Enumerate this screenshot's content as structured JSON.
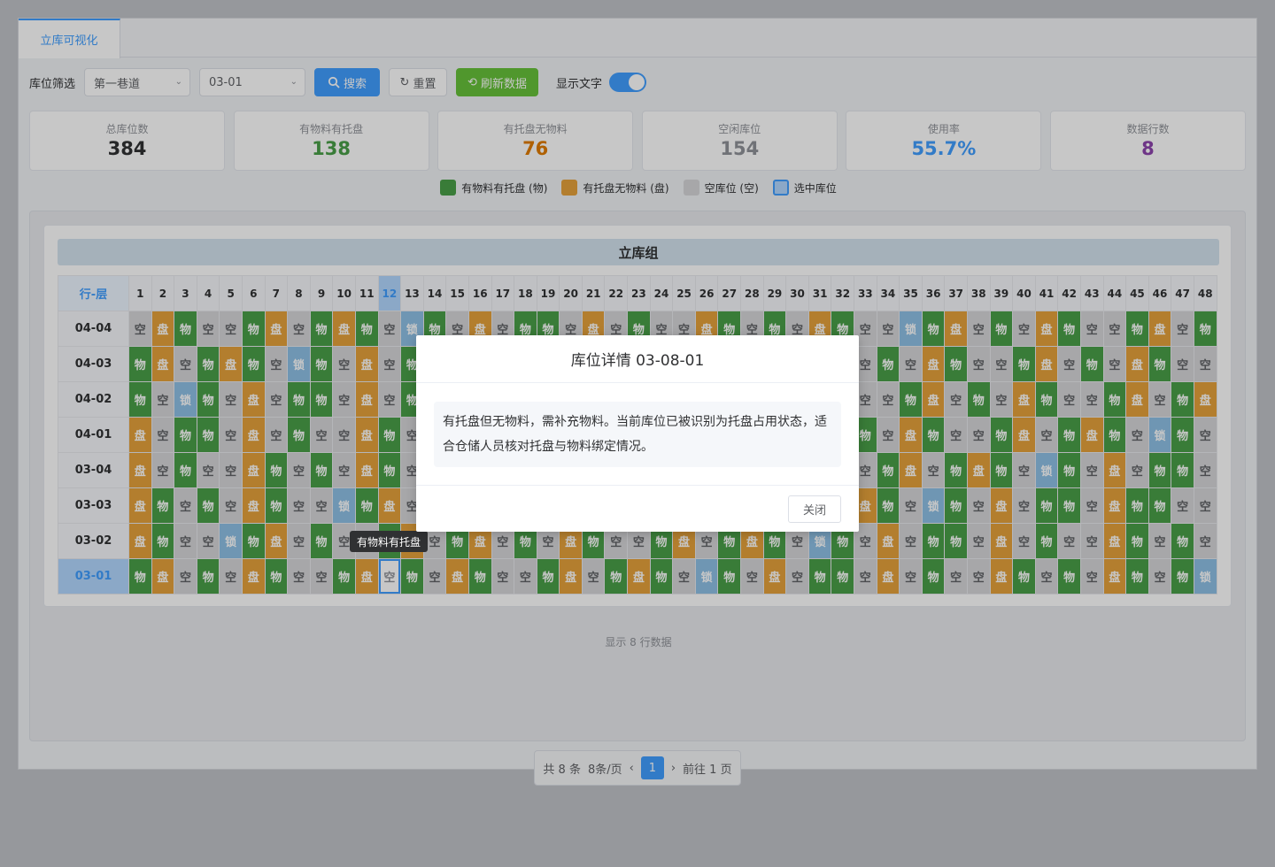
{
  "tab": {
    "label": "立库可视化"
  },
  "filter": {
    "label": "库位筛选",
    "lane": "第一巷道",
    "position": "03-01",
    "search_label": "搜索",
    "reset_label": "重置",
    "refresh_label": "刷新数据",
    "show_text_label": "显示文字",
    "show_text_on": true
  },
  "stats": [
    {
      "label": "总库位数",
      "value": "384",
      "color": "#303133"
    },
    {
      "label": "有物料有托盘",
      "value": "138",
      "color": "#4a9f48"
    },
    {
      "label": "有托盘无物料",
      "value": "76",
      "color": "#e07b00"
    },
    {
      "label": "空闲库位",
      "value": "154",
      "color": "#909399"
    },
    {
      "label": "使用率",
      "value": "55.7%",
      "color": "#409eff"
    },
    {
      "label": "数据行数",
      "value": "8",
      "color": "#8e44ad"
    }
  ],
  "legend": [
    {
      "label": "有物料有托盘 (物)",
      "color": "#4a9f48"
    },
    {
      "label": "有托盘无物料 (盘)",
      "color": "#e6a23c"
    },
    {
      "label": "空库位 (空)",
      "color": "#d6d7d9"
    },
    {
      "label": "选中库位",
      "color": "#b3d8ff"
    }
  ],
  "group_title": "立库组",
  "grid": {
    "corner": "行-层",
    "selected_column": 12,
    "selected_row": "03-01",
    "columns": [
      "1",
      "2",
      "3",
      "4",
      "5",
      "6",
      "7",
      "8",
      "9",
      "10",
      "11",
      "12",
      "13",
      "14",
      "15",
      "16",
      "17",
      "18",
      "19",
      "20",
      "21",
      "22",
      "23",
      "24",
      "25",
      "26",
      "27",
      "28",
      "29",
      "30",
      "31",
      "32",
      "33",
      "34",
      "35",
      "36",
      "37",
      "38",
      "39",
      "40",
      "41",
      "42",
      "43",
      "44",
      "45",
      "46",
      "47",
      "48"
    ],
    "rows": [
      {
        "label": "04-04",
        "cells": "空盘物空空物盘空物盘物空锁物空盘空物物空盘空物空空盘物空物空盘物空空锁物盘空物空盘物空空物盘空物"
      },
      {
        "label": "04-03",
        "cells": "物盘空物盘物空锁物空盘空物空空物空物盘空物空物盘空物空物盘空物空空物空盘物空空物盘空物空盘物空空"
      },
      {
        "label": "04-02",
        "cells": "物空锁物空盘空物物空盘空物空物空物空盘物空物空盘空物空空物盘空物空空物盘空物空盘物空空物盘空物盘"
      },
      {
        "label": "04-01",
        "cells": "盘空物物空盘空物空空盘物空物空盘物空物空盘空物空物空盘物空物空盘物空盘物空空物盘空物盘物空锁物空"
      },
      {
        "label": "03-04",
        "cells": "盘空物空空盘物空物空盘物空物空盘物空物空盘物空空物空盘空物空空物空物盘空物盘物空锁物空盘空物物空"
      },
      {
        "label": "03-03",
        "cells": "盘物空物空盘物空空锁物盘空物空盘物空物空盘物空物空盘物空物空盘空盘物空锁物空盘空物物空盘物物空空"
      },
      {
        "label": "03-02",
        "cells": "盘物空空锁物盘空物空空物盘空物盘空物空盘物空空物盘空物盘物空锁物空盘空物物空盘空物空空盘物空物空"
      },
      {
        "label": "03-01",
        "cells": "物盘空物空盘物空空物盘空物空盘物空空物盘空物盘物空锁物空盘空物物空盘空物空空盘物空物空盘物空物锁"
      }
    ]
  },
  "rows_info": "显示 8 行数据",
  "pager": {
    "total": "共 8 条",
    "per_page": "8条/页",
    "prev": "‹",
    "current": "1",
    "next": "›",
    "goto": "前往 1 页"
  },
  "dialog": {
    "title": "库位详情 03-08-01",
    "body": "有托盘但无物料，需补充物料。当前库位已被识别为托盘占用状态，适合仓储人员核对托盘与物料绑定情况。",
    "close_label": "关闭"
  },
  "tooltip": "有物料有托盘"
}
